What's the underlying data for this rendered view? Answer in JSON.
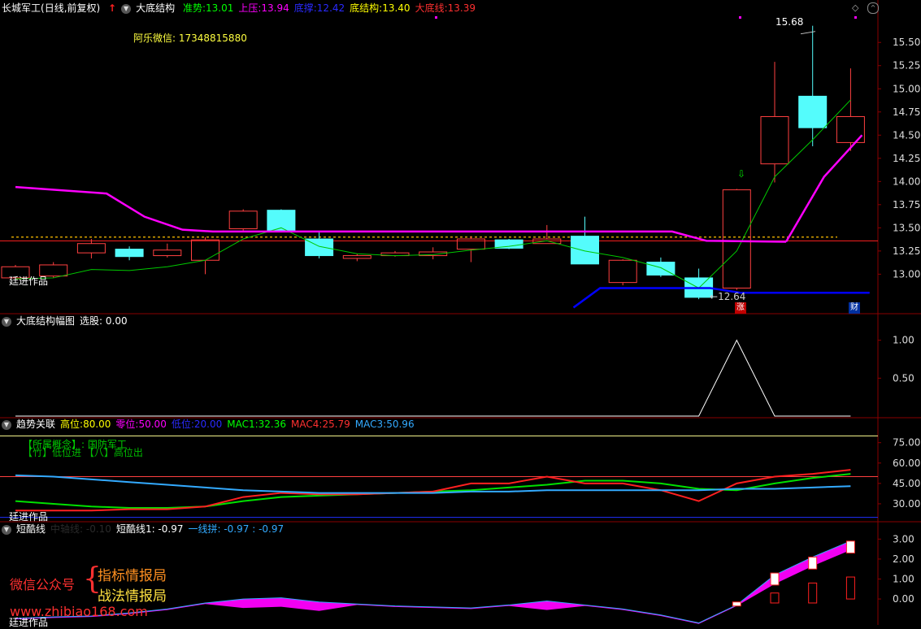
{
  "colors": {
    "bg": "#000000",
    "candle_up": "#ff4040",
    "candle_down": "#54fcfc",
    "ma": "#00c800",
    "magenta": "#ff00ff",
    "blue": "#0000ff",
    "red_line": "#ff2020",
    "orange_dash": "#ffc000",
    "grid": "#7a0000",
    "mac1": "#00e000",
    "mac4": "#ff2020",
    "mac3": "#33aaff",
    "white": "#ffffff",
    "yellow": "#ffff00"
  },
  "panel1": {
    "symbol": "长城军工",
    "period": "(日线,前复权)",
    "indicator": "大底结构",
    "items": [
      {
        "label": "准势:",
        "value": "13.01",
        "color": "#00ff00"
      },
      {
        "label": "上压:",
        "value": "13.94",
        "color": "#ff00ff"
      },
      {
        "label": "底撑:",
        "value": "12.42",
        "color": "#2a2aff"
      },
      {
        "label": "底结构:",
        "value": "13.40",
        "color": "#ffff00"
      },
      {
        "label": "大底线:",
        "value": "13.39",
        "color": "#ff3030"
      }
    ],
    "wechat": "阿乐微信: 17348815880",
    "author": "廷进作品",
    "high_label": "15.68",
    "low_label": "12.64",
    "badge_zhang": "涨",
    "badge_cai": "财"
  },
  "panel2": {
    "title": "大底结构幅图",
    "select": "选股: 0.00"
  },
  "panel3": {
    "title": "趋势关联",
    "items": [
      {
        "label": "高位:",
        "value": "80.00",
        "color": "#ffff00"
      },
      {
        "label": "零位:",
        "value": "50.00",
        "color": "#ff00ff"
      },
      {
        "label": "低位:",
        "value": "20.00",
        "color": "#2a2aff"
      },
      {
        "label": "MAC1:",
        "value": "32.36",
        "color": "#00ff00"
      },
      {
        "label": "MAC4:",
        "value": "25.79",
        "color": "#ff3030"
      },
      {
        "label": "MAC3:",
        "value": "50.96",
        "color": "#33aaff"
      }
    ],
    "concept_line1": "【所属概念】: 国防军工",
    "concept_line2": "【竹】低位进 【八】高位出",
    "author": "廷进作品"
  },
  "panel4": {
    "title": "短酷线",
    "faint": "中轴线: -0.10",
    "item1": "短酷线1: -0.97",
    "item2": "一线拼: -0.97 : -0.97",
    "wx": "微信公众号",
    "brace": "{",
    "name1": "指标情报局",
    "name2": "战法情报局",
    "url": "www.zhibiao168.com",
    "author": "廷进作品"
  },
  "chart_data": [
    {
      "type": "candlestick",
      "name": "长城军工 日线 前复权",
      "ylim": [
        12.6,
        15.8
      ],
      "y_ticks": [
        "15.50",
        "15.25",
        "15.00",
        "14.75",
        "14.50",
        "14.25",
        "14.00",
        "13.75",
        "13.50",
        "13.25",
        "13.00"
      ],
      "candles": [
        {
          "o": 12.96,
          "h": 13.1,
          "l": 12.95,
          "c": 13.08
        },
        {
          "o": 12.98,
          "h": 13.13,
          "l": 12.96,
          "c": 13.1
        },
        {
          "o": 13.23,
          "h": 13.38,
          "l": 13.17,
          "c": 13.33
        },
        {
          "o": 13.27,
          "h": 13.3,
          "l": 13.15,
          "c": 13.19
        },
        {
          "o": 13.2,
          "h": 13.33,
          "l": 13.18,
          "c": 13.26
        },
        {
          "o": 13.15,
          "h": 13.4,
          "l": 13.0,
          "c": 13.37
        },
        {
          "o": 13.49,
          "h": 13.7,
          "l": 13.47,
          "c": 13.68
        },
        {
          "o": 13.69,
          "h": 13.7,
          "l": 13.45,
          "c": 13.47
        },
        {
          "o": 13.38,
          "h": 13.45,
          "l": 13.17,
          "c": 13.2
        },
        {
          "o": 13.17,
          "h": 13.22,
          "l": 13.14,
          "c": 13.2
        },
        {
          "o": 13.2,
          "h": 13.25,
          "l": 13.19,
          "c": 13.23
        },
        {
          "o": 13.2,
          "h": 13.29,
          "l": 13.16,
          "c": 13.24
        },
        {
          "o": 13.27,
          "h": 13.41,
          "l": 13.13,
          "c": 13.38
        },
        {
          "o": 13.37,
          "h": 13.38,
          "l": 13.27,
          "c": 13.28
        },
        {
          "o": 13.33,
          "h": 13.53,
          "l": 13.33,
          "c": 13.38
        },
        {
          "o": 13.41,
          "h": 13.62,
          "l": 13.11,
          "c": 13.11
        },
        {
          "o": 12.91,
          "h": 13.16,
          "l": 12.88,
          "c": 13.15
        },
        {
          "o": 13.13,
          "h": 13.18,
          "l": 12.97,
          "c": 12.99
        },
        {
          "o": 12.96,
          "h": 13.06,
          "l": 12.73,
          "c": 12.75
        },
        {
          "o": 12.85,
          "h": 13.92,
          "l": 12.83,
          "c": 13.91
        },
        {
          "o": 14.19,
          "h": 15.29,
          "l": 13.99,
          "c": 14.7
        },
        {
          "o": 14.92,
          "h": 15.68,
          "l": 14.38,
          "c": 14.58
        },
        {
          "o": 14.42,
          "h": 15.22,
          "l": 14.33,
          "c": 14.7
        }
      ],
      "ma": [
        12.95,
        12.96,
        13.05,
        13.04,
        13.08,
        13.15,
        13.38,
        13.5,
        13.3,
        13.22,
        13.2,
        13.21,
        13.26,
        13.3,
        13.36,
        13.25,
        13.18,
        13.07,
        12.85,
        13.25,
        14.05,
        14.45,
        14.88
      ],
      "upper_pressure": [
        {
          "x": 0,
          "y": 13.94
        },
        {
          "x": 2.4,
          "y": 13.87
        },
        {
          "x": 3.4,
          "y": 13.62
        },
        {
          "x": 4.4,
          "y": 13.48
        },
        {
          "x": 5.2,
          "y": 13.46
        },
        {
          "x": 17.3,
          "y": 13.46
        },
        {
          "x": 18.2,
          "y": 13.36
        },
        {
          "x": 20.3,
          "y": 13.35
        }
      ],
      "upper_pressure_2": [
        {
          "x": 20.3,
          "y": 13.35
        },
        {
          "x": 21.3,
          "y": 14.05
        },
        {
          "x": 22.3,
          "y": 14.5
        }
      ],
      "support": [
        {
          "x": 14.7,
          "y": 12.64
        },
        {
          "x": 15.4,
          "y": 12.85
        },
        {
          "x": 18.3,
          "y": 12.85
        },
        {
          "x": 19.1,
          "y": 12.8
        },
        {
          "x": 22.5,
          "y": 12.8
        }
      ],
      "big_bottom_line": 13.36,
      "bottom_structure_line": 13.4
    },
    {
      "type": "line",
      "name": "大底结构幅图",
      "ylim": [
        0,
        1.2
      ],
      "y_ticks": [
        "1.00",
        "0.50"
      ],
      "values": [
        0,
        0,
        0,
        0,
        0,
        0,
        0,
        0,
        0,
        0,
        0,
        0,
        0,
        0,
        0,
        0,
        0,
        0,
        0,
        1,
        0,
        0,
        0
      ]
    },
    {
      "type": "line",
      "name": "趋势关联",
      "ylim": [
        18,
        85
      ],
      "y_ticks": [
        "75.00",
        "60.00",
        "45.00",
        "30.00"
      ],
      "series": [
        {
          "name": "MAC1",
          "color": "#00e000",
          "values": [
            32,
            30,
            28,
            27,
            27,
            28,
            32,
            35,
            36,
            37,
            38,
            39,
            40,
            42,
            44,
            47,
            47,
            45,
            41,
            40,
            45,
            49,
            52
          ]
        },
        {
          "name": "MAC4",
          "color": "#ff2020",
          "values": [
            25,
            25,
            25,
            26,
            26,
            28,
            35,
            38,
            37,
            37,
            38,
            39,
            45,
            45,
            50,
            45,
            45,
            40,
            32,
            45,
            50,
            52,
            55
          ]
        },
        {
          "name": "MAC3",
          "color": "#33aaff",
          "values": [
            51,
            50,
            48,
            46,
            44,
            42,
            40,
            39,
            38,
            38,
            38,
            38,
            39,
            39,
            40,
            40,
            40,
            40,
            40,
            41,
            41,
            42,
            43
          ]
        }
      ]
    },
    {
      "type": "area",
      "name": "短酷线",
      "ylim": [
        -1.3,
        3.3
      ],
      "y_ticks": [
        "3.00",
        "2.00",
        "1.00",
        "0.00"
      ],
      "values": [
        -0.97,
        -0.9,
        -0.85,
        -0.7,
        -0.5,
        -0.2,
        0.0,
        0.06,
        -0.15,
        -0.25,
        -0.35,
        -0.4,
        -0.45,
        -0.3,
        -0.1,
        -0.3,
        -0.5,
        -0.8,
        -1.2,
        -0.3,
        1.2,
        2.1,
        2.9
      ]
    }
  ]
}
